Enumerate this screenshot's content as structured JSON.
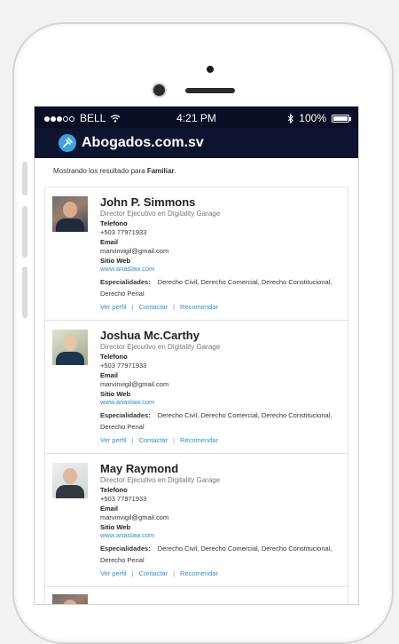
{
  "status_bar": {
    "carrier": "BELL",
    "time": "4:21 PM",
    "battery": "100%"
  },
  "app": {
    "title": "Abogados.com.sv"
  },
  "results": {
    "prefix": "Mostrando los resultado para ",
    "query": "Familiar",
    "suffix": "."
  },
  "labels": {
    "phone": "Telefono",
    "email": "Email",
    "website": "Sitio Web",
    "specialties": "Especialidades:",
    "view_profile": "Ver perfil",
    "contact": "Contactar",
    "recommend": "Recomendar"
  },
  "lawyers": [
    {
      "name": "John P. Simmons",
      "role": "Director Ejecutivo en Digitality Garage",
      "phone": "+503 77971933",
      "email": "marvinvigil@gmail.com",
      "website": "www.ariaslaw.com",
      "specialties": "Derecho Civil, Derecho Comercial, Derecho Constitucional, Derecho Penal"
    },
    {
      "name": "Joshua Mc.Carthy",
      "role": "Director Ejecutivo en Digitality Garage",
      "phone": "+503 77971933",
      "email": "marvinvigil@gmail.com",
      "website": "www.ariaslaw.com",
      "specialties": "Derecho Civil, Derecho Comercial, Derecho Constitucional, Derecho Penal"
    },
    {
      "name": "May Raymond",
      "role": "Director Ejecutivo en Digitality Garage",
      "phone": "+503 77971933",
      "email": "marvinvigil@gmail.com",
      "website": "www.ariaslaw.com",
      "specialties": "Derecho Civil, Derecho Comercial, Derecho Constitucional, Derecho Penal"
    }
  ],
  "colors": {
    "header_bg": "#0e1430",
    "link": "#2a8fd6",
    "logo": "#3ba3dc"
  }
}
